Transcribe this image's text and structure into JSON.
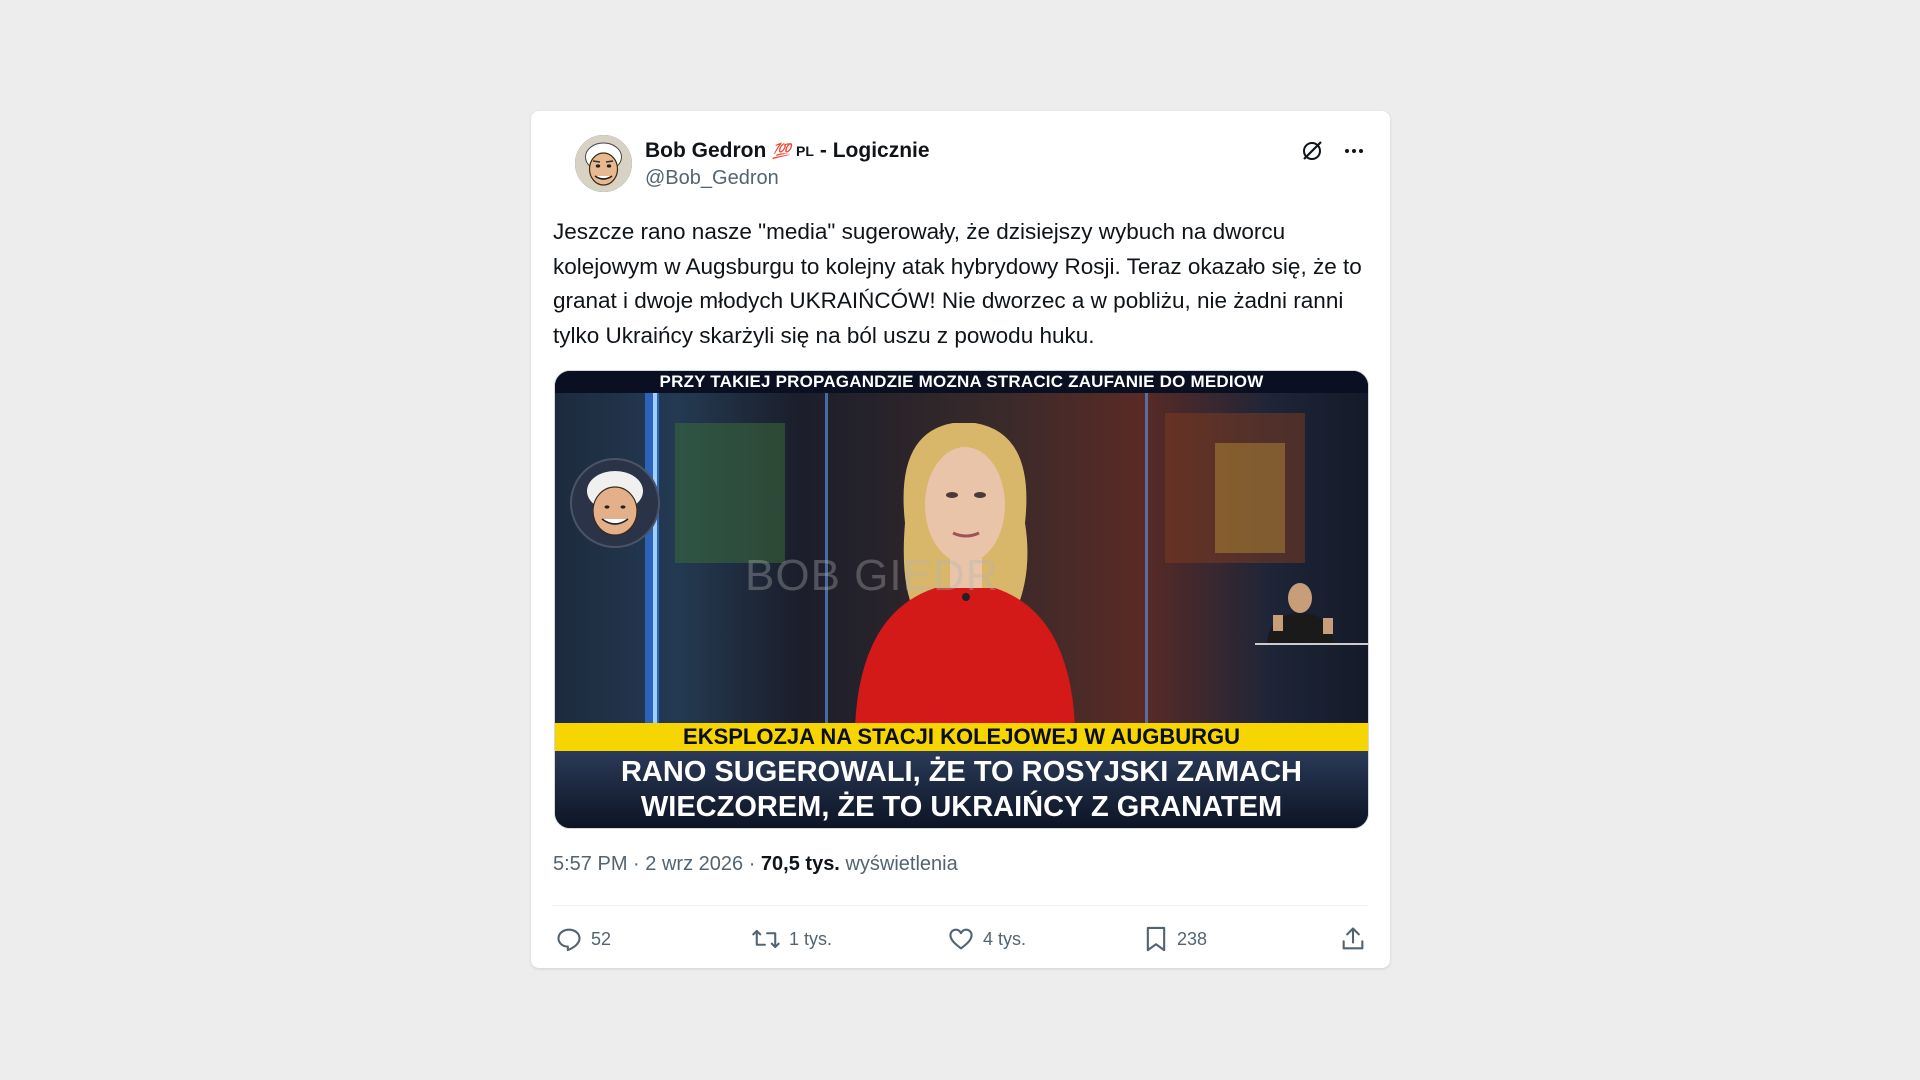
{
  "author": {
    "name": "Bob Gedron",
    "emoji": "💯",
    "flag": "PL",
    "suffix": "- Logicznie",
    "handle": "@Bob_Gedron"
  },
  "post": {
    "text": "Jeszcze rano nasze \"media\" sugerowały, że dzisiejszy wybuch na dworcu kolejowym w Augsburgu to kolejny atak hybrydowy Rosji. Teraz okazało się, że to granat i dwoje młodych UKRAIŃCÓW! Nie dworzec a w pobliżu, nie żadni ranni tylko Ukraińcy skarżyli się na ból uszu z powodu huku."
  },
  "media": {
    "top_caption": "PRZY TAKIEJ PROPAGANDZIE MOZNA STRACIC ZAUFANIE DO MEDIOW",
    "watermark": "BOB GIEDR",
    "yellow_caption": "EKSPLOZJA NA STACJI KOLEJOWEJ W AUGBURGU",
    "bottom_line1": "RANO SUGEROWALI, ŻE TO ROSYJSKI ZAMACH",
    "bottom_line2": "WIECZOREM, ŻE TO UKRAIŃCY Z GRANATEM"
  },
  "meta": {
    "time": "5:57 PM",
    "sep": "·",
    "date": "2 wrz 2026",
    "views_count": "70,5 tys.",
    "views_label": "wyświetlenia"
  },
  "actions": {
    "replies": "52",
    "reposts": "1 tys.",
    "likes": "4 tys.",
    "bookmarks": "238"
  },
  "icons": {
    "grok": "grok-icon",
    "more": "more-icon",
    "reply": "reply-icon",
    "repost": "repost-icon",
    "like": "heart-icon",
    "bookmark": "bookmark-icon",
    "share": "share-icon"
  }
}
